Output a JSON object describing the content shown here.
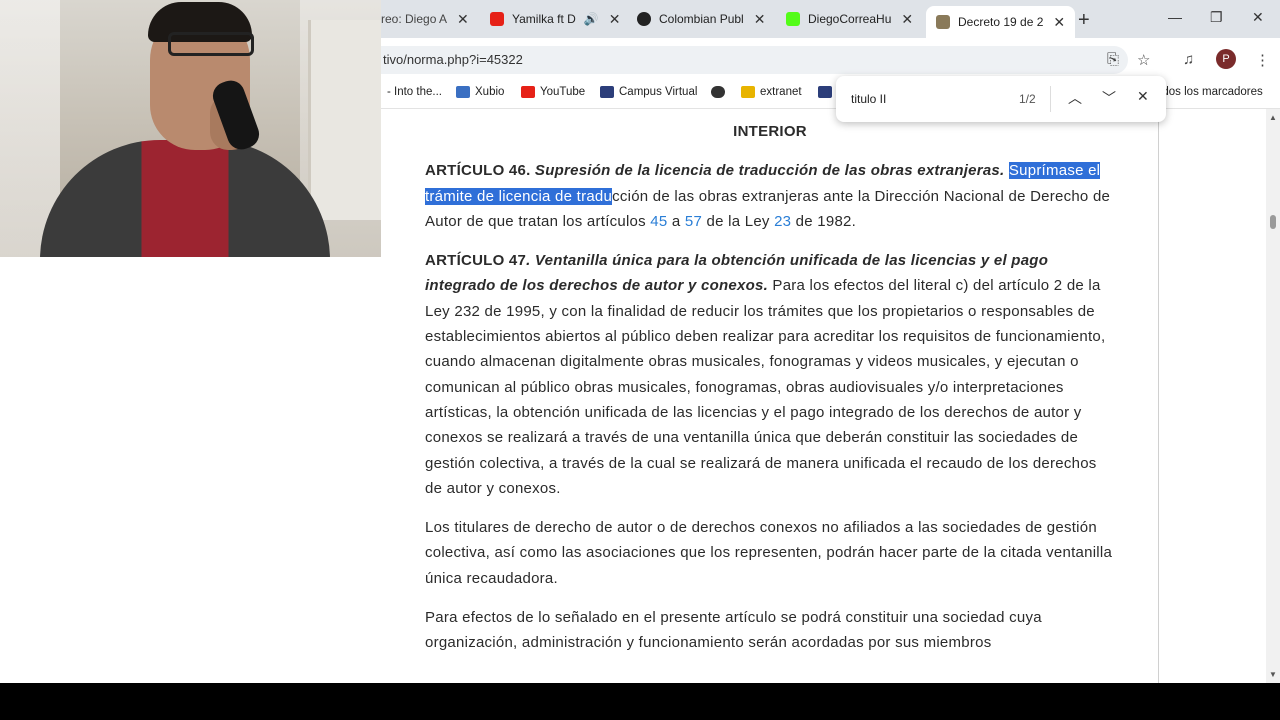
{
  "tabs": [
    {
      "label": "reo: Diego A",
      "close": "✕"
    },
    {
      "label": "Yamilka ft D",
      "close": "✕"
    },
    {
      "label": "Colombian Publ",
      "close": "✕"
    },
    {
      "label": "DiegoCorreaHu",
      "close": "✕"
    },
    {
      "label": "Decreto 19 de 2",
      "close": "✕"
    }
  ],
  "url": "tivo/norma.php?i=45322",
  "bookmarks": [
    {
      "label": "- Into the..."
    },
    {
      "label": "Xubio"
    },
    {
      "label": "YouTube"
    },
    {
      "label": "Campus Virtual"
    },
    {
      "label": ""
    },
    {
      "label": "extranet"
    },
    {
      "label": "odos los marcadores"
    }
  ],
  "find": {
    "query": "titulo II",
    "count": "1/2"
  },
  "profile_initial": "P",
  "doc": {
    "section_title": "INTERIOR",
    "art46_head": "ARTÍCULO 46.",
    "art46_title": " Supresión de la licencia de traducción de las obras extranjeras.",
    "art46_hl": "Suprímase el trámite de licencia de tradu",
    "art46_text1": "cción de las obras extranjeras ante la Dirección Nacional de Derecho de Autor de que tratan los artículos ",
    "art46_link1": "45",
    "art46_text2": " a ",
    "art46_link2": "57",
    "art46_text3": " de la Ley ",
    "art46_link3": "23",
    "art46_text4": " de 1982.",
    "art47_head": "ARTÍCULO 47",
    "art47_title": ". Ventanilla única para la obtención unificada de las licencias y el pago integrado de los derechos de autor y conexos.",
    "art47_text": " Para los efectos del literal c) del artículo 2 de la Ley 232 de 1995, y con la finalidad de reducir los trámites que los propietarios o responsables de establecimientos abiertos al público deben realizar para acreditar los requisitos de funcionamiento, cuando almacenan digitalmente obras musicales, fonogramas y videos musicales, y ejecutan o comunican al público obras musicales, fonogramas, obras audiovisuales y/o interpretaciones artísticas, la obtención unificada de las licencias y el pago integrado de los derechos de autor y conexos se realizará a través de una ventanilla única que deberán constituir las sociedades de gestión colectiva, a través de la cual se realizará de manera unificada el recaudo de los derechos de autor y conexos.",
    "para2": "Los titulares de derecho de autor o de derechos conexos no afiliados a las sociedades de gestión colectiva, así como las asociaciones que los representen, podrán hacer parte de la citada ventanilla única recaudadora.",
    "para3": "Para efectos de lo señalado en el presente artículo se podrá constituir una sociedad cuya organización, administración y funcionamiento serán acordadas por sus miembros"
  },
  "colors": {
    "tab_bg": "#dfe3e8",
    "highlight": "#2f6fd8",
    "link": "#2a7ed6"
  }
}
